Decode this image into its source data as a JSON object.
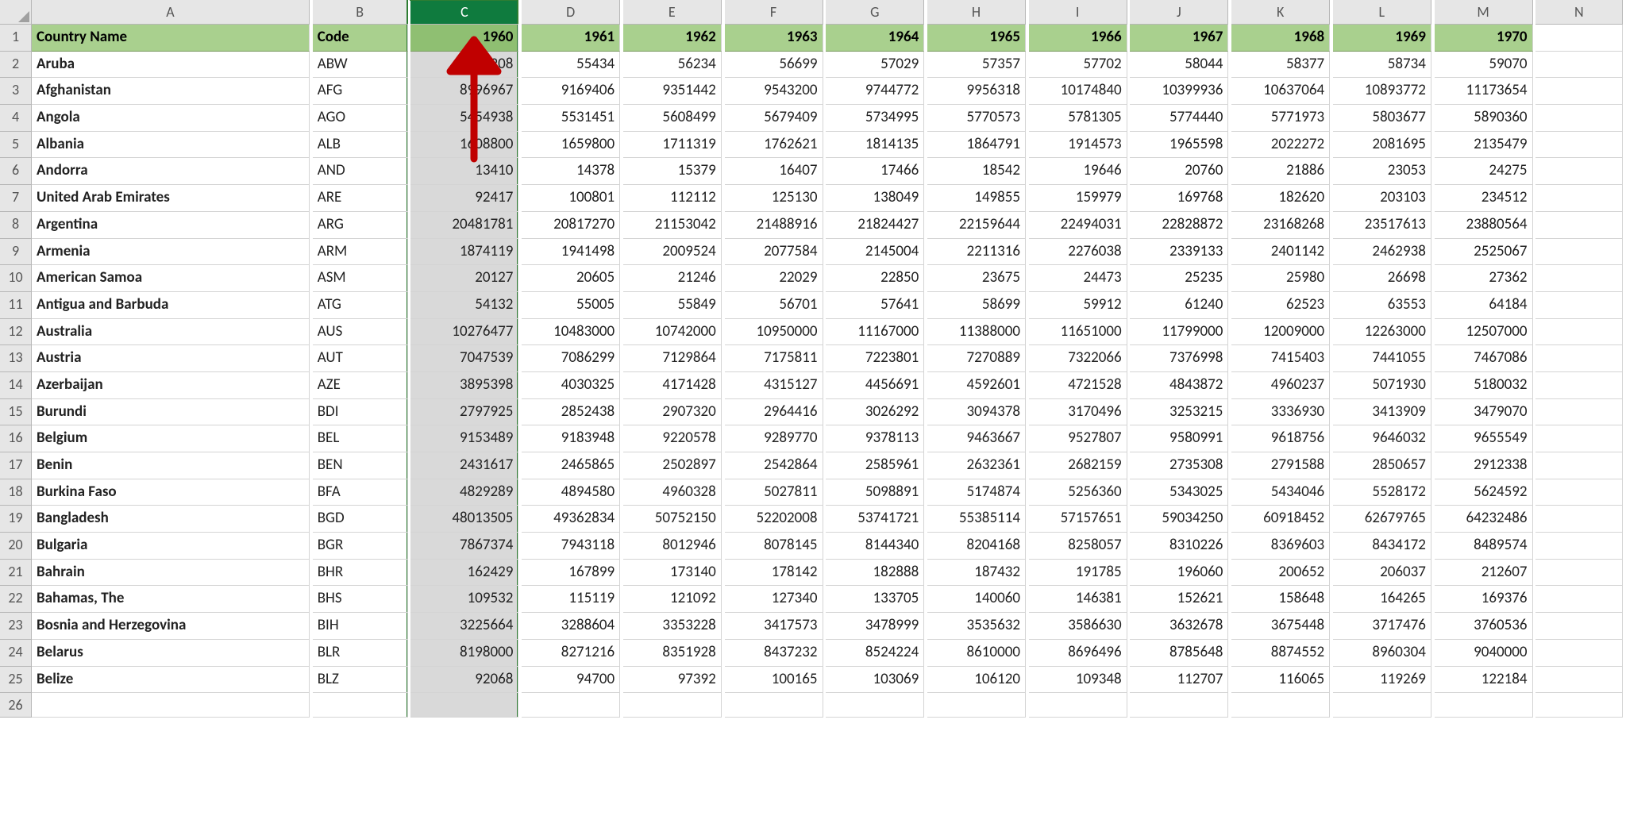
{
  "columns": [
    "A",
    "B",
    "C",
    "D",
    "E",
    "F",
    "G",
    "H",
    "I",
    "J",
    "K",
    "L",
    "M",
    "N"
  ],
  "selected_column": "C",
  "header": {
    "country": "Country Name",
    "code": "Code",
    "years": [
      "1960",
      "1961",
      "1962",
      "1963",
      "1964",
      "1965",
      "1966",
      "1967",
      "1968",
      "1969",
      "1970"
    ]
  },
  "rows": [
    {
      "n": 2,
      "country": "Aruba",
      "code": "ABW",
      "v": [
        "54208",
        "55434",
        "56234",
        "56699",
        "57029",
        "57357",
        "57702",
        "58044",
        "58377",
        "58734",
        "59070"
      ]
    },
    {
      "n": 3,
      "country": "Afghanistan",
      "code": "AFG",
      "v": [
        "8996967",
        "9169406",
        "9351442",
        "9543200",
        "9744772",
        "9956318",
        "10174840",
        "10399936",
        "10637064",
        "10893772",
        "11173654"
      ]
    },
    {
      "n": 4,
      "country": "Angola",
      "code": "AGO",
      "v": [
        "5454938",
        "5531451",
        "5608499",
        "5679409",
        "5734995",
        "5770573",
        "5781305",
        "5774440",
        "5771973",
        "5803677",
        "5890360"
      ]
    },
    {
      "n": 5,
      "country": "Albania",
      "code": "ALB",
      "v": [
        "1608800",
        "1659800",
        "1711319",
        "1762621",
        "1814135",
        "1864791",
        "1914573",
        "1965598",
        "2022272",
        "2081695",
        "2135479"
      ]
    },
    {
      "n": 6,
      "country": "Andorra",
      "code": "AND",
      "v": [
        "13410",
        "14378",
        "15379",
        "16407",
        "17466",
        "18542",
        "19646",
        "20760",
        "21886",
        "23053",
        "24275"
      ]
    },
    {
      "n": 7,
      "country": "United Arab Emirates",
      "code": "ARE",
      "v": [
        "92417",
        "100801",
        "112112",
        "125130",
        "138049",
        "149855",
        "159979",
        "169768",
        "182620",
        "203103",
        "234512"
      ]
    },
    {
      "n": 8,
      "country": "Argentina",
      "code": "ARG",
      "v": [
        "20481781",
        "20817270",
        "21153042",
        "21488916",
        "21824427",
        "22159644",
        "22494031",
        "22828872",
        "23168268",
        "23517613",
        "23880564"
      ]
    },
    {
      "n": 9,
      "country": "Armenia",
      "code": "ARM",
      "v": [
        "1874119",
        "1941498",
        "2009524",
        "2077584",
        "2145004",
        "2211316",
        "2276038",
        "2339133",
        "2401142",
        "2462938",
        "2525067"
      ]
    },
    {
      "n": 10,
      "country": "American Samoa",
      "code": "ASM",
      "v": [
        "20127",
        "20605",
        "21246",
        "22029",
        "22850",
        "23675",
        "24473",
        "25235",
        "25980",
        "26698",
        "27362"
      ]
    },
    {
      "n": 11,
      "country": "Antigua and Barbuda",
      "code": "ATG",
      "v": [
        "54132",
        "55005",
        "55849",
        "56701",
        "57641",
        "58699",
        "59912",
        "61240",
        "62523",
        "63553",
        "64184"
      ]
    },
    {
      "n": 12,
      "country": "Australia",
      "code": "AUS",
      "v": [
        "10276477",
        "10483000",
        "10742000",
        "10950000",
        "11167000",
        "11388000",
        "11651000",
        "11799000",
        "12009000",
        "12263000",
        "12507000"
      ]
    },
    {
      "n": 13,
      "country": "Austria",
      "code": "AUT",
      "v": [
        "7047539",
        "7086299",
        "7129864",
        "7175811",
        "7223801",
        "7270889",
        "7322066",
        "7376998",
        "7415403",
        "7441055",
        "7467086"
      ]
    },
    {
      "n": 14,
      "country": "Azerbaijan",
      "code": "AZE",
      "v": [
        "3895398",
        "4030325",
        "4171428",
        "4315127",
        "4456691",
        "4592601",
        "4721528",
        "4843872",
        "4960237",
        "5071930",
        "5180032"
      ]
    },
    {
      "n": 15,
      "country": "Burundi",
      "code": "BDI",
      "v": [
        "2797925",
        "2852438",
        "2907320",
        "2964416",
        "3026292",
        "3094378",
        "3170496",
        "3253215",
        "3336930",
        "3413909",
        "3479070"
      ]
    },
    {
      "n": 16,
      "country": "Belgium",
      "code": "BEL",
      "v": [
        "9153489",
        "9183948",
        "9220578",
        "9289770",
        "9378113",
        "9463667",
        "9527807",
        "9580991",
        "9618756",
        "9646032",
        "9655549"
      ]
    },
    {
      "n": 17,
      "country": "Benin",
      "code": "BEN",
      "v": [
        "2431617",
        "2465865",
        "2502897",
        "2542864",
        "2585961",
        "2632361",
        "2682159",
        "2735308",
        "2791588",
        "2850657",
        "2912338"
      ]
    },
    {
      "n": 18,
      "country": "Burkina Faso",
      "code": "BFA",
      "v": [
        "4829289",
        "4894580",
        "4960328",
        "5027811",
        "5098891",
        "5174874",
        "5256360",
        "5343025",
        "5434046",
        "5528172",
        "5624592"
      ]
    },
    {
      "n": 19,
      "country": "Bangladesh",
      "code": "BGD",
      "v": [
        "48013505",
        "49362834",
        "50752150",
        "52202008",
        "53741721",
        "55385114",
        "57157651",
        "59034250",
        "60918452",
        "62679765",
        "64232486"
      ]
    },
    {
      "n": 20,
      "country": "Bulgaria",
      "code": "BGR",
      "v": [
        "7867374",
        "7943118",
        "8012946",
        "8078145",
        "8144340",
        "8204168",
        "8258057",
        "8310226",
        "8369603",
        "8434172",
        "8489574"
      ]
    },
    {
      "n": 21,
      "country": "Bahrain",
      "code": "BHR",
      "v": [
        "162429",
        "167899",
        "173140",
        "178142",
        "182888",
        "187432",
        "191785",
        "196060",
        "200652",
        "206037",
        "212607"
      ]
    },
    {
      "n": 22,
      "country": "Bahamas, The",
      "code": "BHS",
      "v": [
        "109532",
        "115119",
        "121092",
        "127340",
        "133705",
        "140060",
        "146381",
        "152621",
        "158648",
        "164265",
        "169376"
      ]
    },
    {
      "n": 23,
      "country": "Bosnia and Herzegovina",
      "code": "BIH",
      "v": [
        "3225664",
        "3288604",
        "3353228",
        "3417573",
        "3478999",
        "3535632",
        "3586630",
        "3632678",
        "3675448",
        "3717476",
        "3760536"
      ]
    },
    {
      "n": 24,
      "country": "Belarus",
      "code": "BLR",
      "v": [
        "8198000",
        "8271216",
        "8351928",
        "8437232",
        "8524224",
        "8610000",
        "8696496",
        "8785648",
        "8874552",
        "8960304",
        "9040000"
      ]
    },
    {
      "n": 25,
      "country": "Belize",
      "code": "BLZ",
      "v": [
        "92068",
        "94700",
        "97392",
        "100165",
        "103069",
        "106120",
        "109348",
        "112707",
        "116065",
        "119269",
        "122184"
      ]
    }
  ],
  "empty_row": 26,
  "annotation": {
    "type": "arrow-up",
    "color": "#c00000",
    "over_column": "C"
  }
}
